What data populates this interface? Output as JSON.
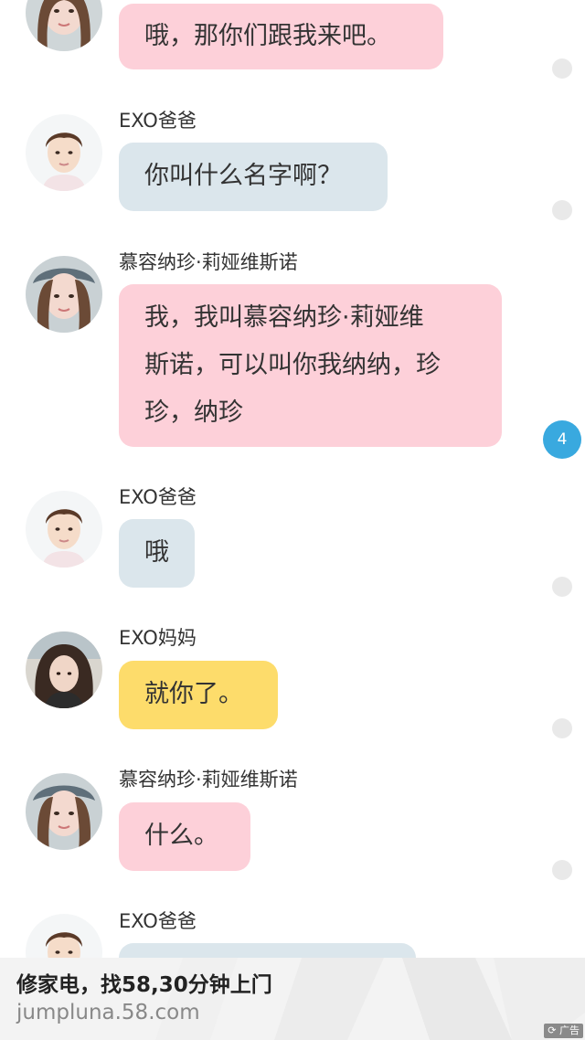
{
  "messages": [
    {
      "sender": "",
      "avatar": "girl-avatar",
      "text_lines": [
        "哦，那你们跟我来吧。"
      ],
      "bubble_color": "#fdd0d9"
    },
    {
      "sender": "EXO爸爸",
      "avatar": "boy-avatar",
      "text_lines": [
        "你叫什么名字啊？"
      ],
      "bubble_color": "#dbe6ec"
    },
    {
      "sender": "慕容纳珍·莉娅维斯诺",
      "avatar": "girl-avatar",
      "text_lines": [
        "我，我叫慕容纳珍·莉娅维",
        "斯诺，可以叫你我纳纳，珍",
        "珍，纳珍"
      ],
      "bubble_color": "#fdd0d9"
    },
    {
      "sender": "EXO爸爸",
      "avatar": "boy-avatar",
      "text_lines": [
        "哦"
      ],
      "bubble_color": "#dbe6ec"
    },
    {
      "sender": "EXO妈妈",
      "avatar": "mom-avatar",
      "text_lines": [
        "就你了。"
      ],
      "bubble_color": "#fddc6b"
    },
    {
      "sender": "慕容纳珍·莉娅维斯诺",
      "avatar": "girl-avatar",
      "text_lines": [
        "什么。"
      ],
      "bubble_color": "#fdd0d9"
    },
    {
      "sender": "EXO爸爸",
      "avatar": "boy-avatar",
      "text_lines": [
        ""
      ],
      "bubble_color": "#dbe6ec"
    }
  ],
  "comment_badge": {
    "count": "4",
    "color": "#39a9df"
  },
  "ad": {
    "title": "修家电，找58,30分钟上门",
    "url": "jumpluna.58.com",
    "tag": "广告"
  }
}
